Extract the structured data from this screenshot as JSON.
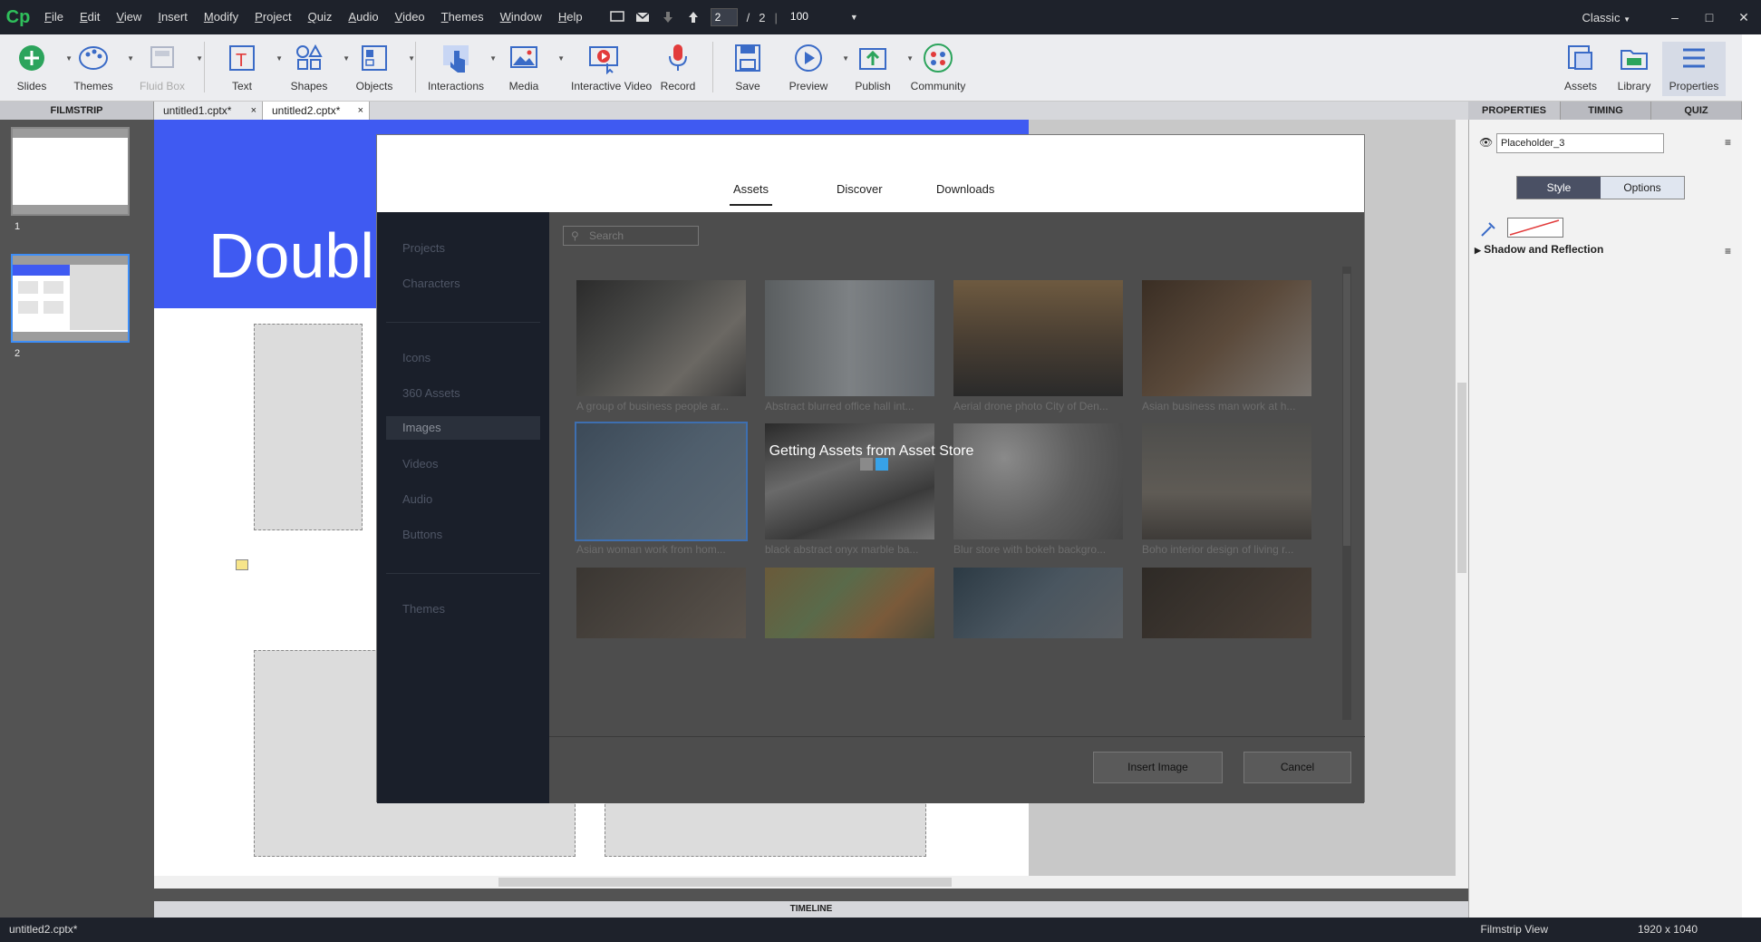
{
  "app": {
    "logo": "Cp",
    "menu": [
      "File",
      "Edit",
      "View",
      "Insert",
      "Modify",
      "Project",
      "Quiz",
      "Audio",
      "Video",
      "Themes",
      "Window",
      "Help"
    ],
    "page_current": "2",
    "page_separator": "/",
    "page_total": "2",
    "zoom": "100",
    "workspace": "Classic"
  },
  "toolbar": {
    "slides": "Slides",
    "themes": "Themes",
    "fluid_box": "Fluid Box",
    "text": "Text",
    "shapes": "Shapes",
    "objects": "Objects",
    "interactions": "Interactions",
    "media": "Media",
    "interactive_video": "Interactive Video",
    "record": "Record",
    "save": "Save",
    "preview": "Preview",
    "publish": "Publish",
    "community": "Community",
    "assets": "Assets",
    "library": "Library",
    "properties": "Properties"
  },
  "panels": {
    "filmstrip": "FILMSTRIP",
    "tabs": [
      "untitled1.cptx*",
      "untitled2.cptx*"
    ],
    "properties": "PROPERTIES",
    "timing": "TIMING",
    "quiz": "QUIZ",
    "timeline": "TIMELINE"
  },
  "filmstrip": {
    "slide_numbers": [
      "1",
      "2"
    ]
  },
  "slide": {
    "title": "Double"
  },
  "properties": {
    "object_name": "Placeholder_3",
    "style_tab": "Style",
    "options_tab": "Options",
    "shadow_section": "Shadow and Reflection"
  },
  "dialog": {
    "tabs": [
      "Assets",
      "Discover",
      "Downloads"
    ],
    "sidebar": [
      "Projects",
      "Characters",
      "Icons",
      "360 Assets",
      "Images",
      "Videos",
      "Audio",
      "Buttons",
      "Themes"
    ],
    "search_placeholder": "Search",
    "images": [
      "A group of business people ar...",
      "Abstract blurred office hall int...",
      "Aerial drone photo City of Den...",
      "Asian business man work at h...",
      "Asian woman work from hom...",
      "black abstract onyx marble ba...",
      "Blur store with bokeh backgro...",
      "Boho interior design of living r..."
    ],
    "loading_text": "Getting Assets from Asset Store",
    "insert_button": "Insert Image",
    "cancel_button": "Cancel"
  },
  "status": {
    "filename": "untitled2.cptx*",
    "view": "Filmstrip View",
    "size": "1920 x 1040"
  }
}
